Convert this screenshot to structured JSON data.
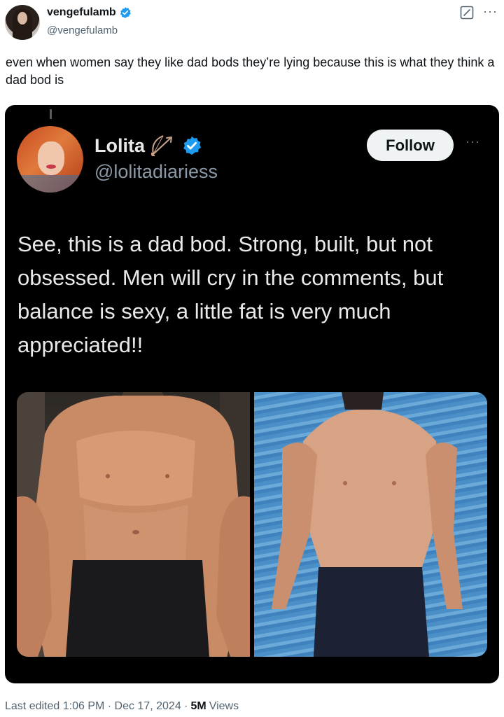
{
  "author": {
    "display_name": "vengefulamb",
    "handle": "@vengefulamb"
  },
  "tweet": {
    "text": "even when women say they like dad bods they’re lying because this is what they think a dad bod is"
  },
  "quoted": {
    "display_name": "Lolita",
    "handle": "@lolitadiariess",
    "follow_label": "Follow",
    "text": "See, this is a dad bod. Strong, built, but not obsessed. Men will cry in the comments, but balance is sexy, a little fat is very much appreciated!!"
  },
  "meta": {
    "edited": "Last edited 1:06 PM · Dec 17, 2024 ·",
    "views_count": "5M",
    "views_label": "Views"
  },
  "icons": {
    "verified": "verified-badge-icon",
    "edit": "edit-icon",
    "more": "more-icon",
    "bow": "bow-and-arrow-icon"
  },
  "colors": {
    "verified_blue": "#1d9bf0",
    "text_primary": "#0f1419",
    "text_secondary": "#536471"
  }
}
